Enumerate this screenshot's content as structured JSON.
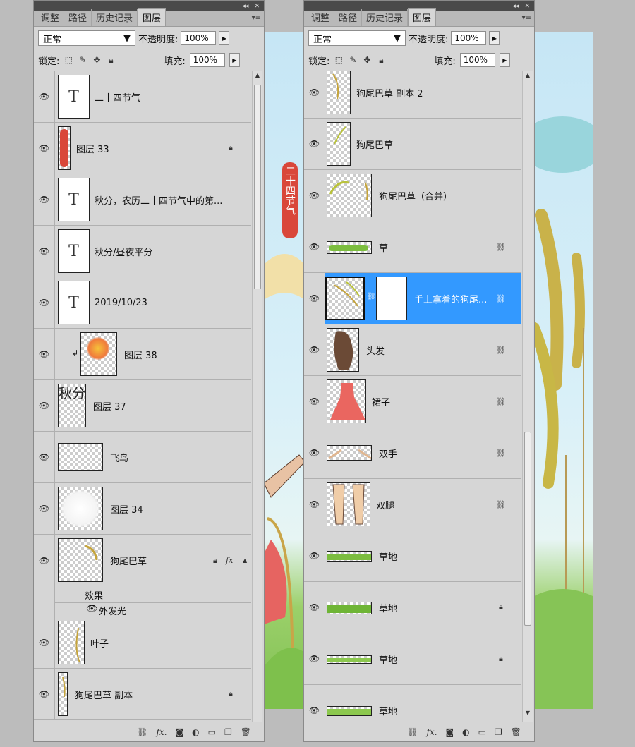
{
  "tabs": [
    "调整",
    "路径",
    "历史记录",
    "图层"
  ],
  "blend_mode": "正常",
  "opacity_label": "不透明度:",
  "opacity_value": "100%",
  "lock_label": "锁定:",
  "fill_label": "填充:",
  "fill_value": "100%",
  "artwork_vertical_title": "二十四节气",
  "left_layers": [
    {
      "name": "二十四节气",
      "kind": "text",
      "thumb_glyph": "T"
    },
    {
      "name": "图层 33",
      "kind": "image",
      "locked": true
    },
    {
      "name": "秋分，农历二十四节气中的第...",
      "kind": "text",
      "thumb_glyph": "T"
    },
    {
      "name": "秋分/昼夜平分",
      "kind": "text",
      "thumb_glyph": "T"
    },
    {
      "name": "2019/10/23",
      "kind": "text",
      "thumb_glyph": "T"
    },
    {
      "name": "图层 38",
      "kind": "image",
      "clipped": true
    },
    {
      "name": "图层 37",
      "kind": "image",
      "thumb_glyph": "秋分"
    },
    {
      "name": "飞鸟",
      "kind": "image"
    },
    {
      "name": "图层 34",
      "kind": "image"
    },
    {
      "name": "狗尾巴草",
      "kind": "image",
      "locked": true,
      "fx": "fx",
      "effects_label": "效果",
      "effect_item": "外发光"
    },
    {
      "name": "叶子",
      "kind": "image"
    },
    {
      "name": "狗尾巴草 副本",
      "kind": "image",
      "locked": true
    }
  ],
  "right_layers": [
    {
      "name": "狗尾巴草 副本 2",
      "kind": "image"
    },
    {
      "name": "狗尾巴草",
      "kind": "image"
    },
    {
      "name": "狗尾巴草（合并）",
      "kind": "image"
    },
    {
      "name": "草",
      "kind": "image",
      "linked": true
    },
    {
      "name": "手上拿着的狗尾...",
      "kind": "image",
      "linked": true,
      "selected": true,
      "mask": true
    },
    {
      "name": "头发",
      "kind": "image",
      "linked": true
    },
    {
      "name": "裙子",
      "kind": "image",
      "linked": true
    },
    {
      "name": "双手",
      "kind": "image",
      "linked": true
    },
    {
      "name": "双腿",
      "kind": "image",
      "linked": true
    },
    {
      "name": "草地",
      "kind": "image"
    },
    {
      "name": "草地",
      "kind": "image",
      "locked": true
    },
    {
      "name": "草地",
      "kind": "image",
      "locked": true
    },
    {
      "name": "草地",
      "kind": "image"
    }
  ],
  "bottom_icons": [
    "link-icon",
    "fx-icon",
    "mask-icon",
    "adjustment-icon",
    "folder-icon",
    "new-layer-icon",
    "trash-icon"
  ]
}
